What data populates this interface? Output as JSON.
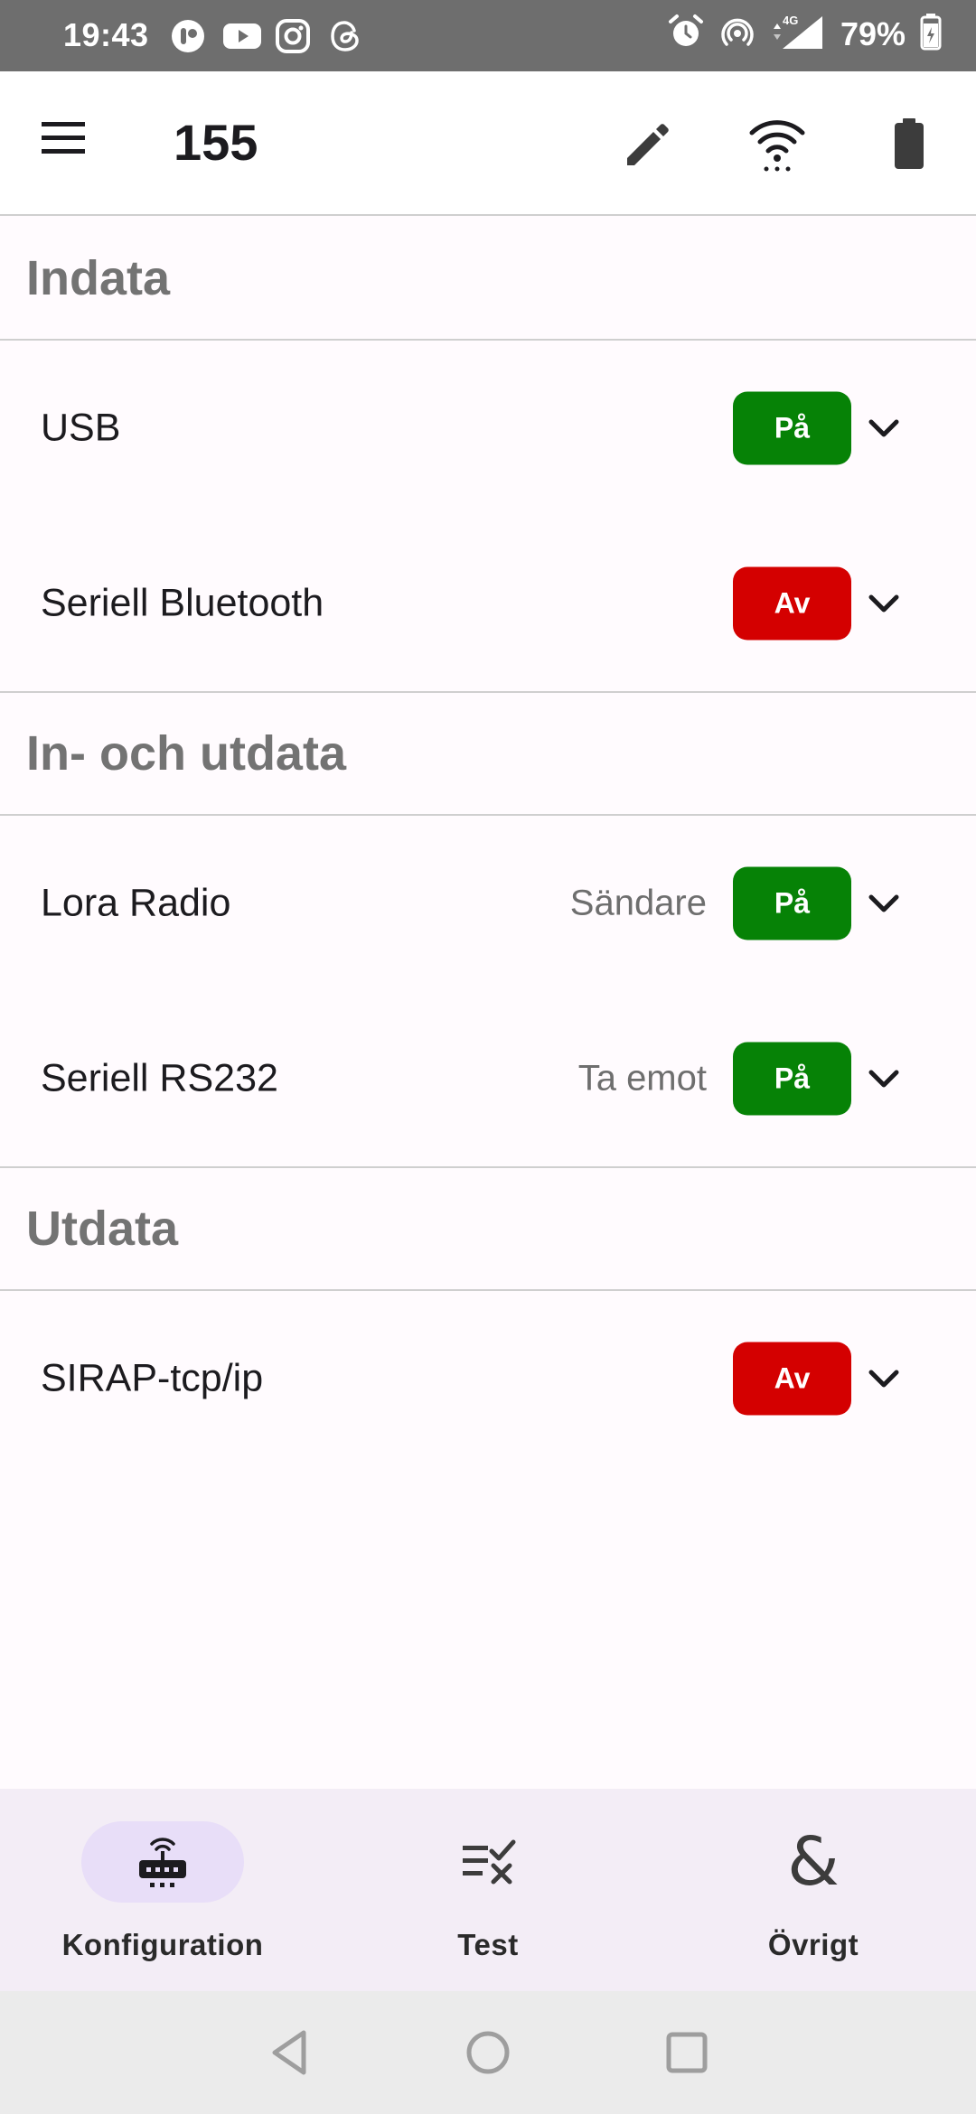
{
  "status_bar": {
    "time": "19:43",
    "battery_percent": "79%",
    "network": "4G"
  },
  "app_bar": {
    "title": "155"
  },
  "sections": [
    {
      "title": "Indata",
      "rows": [
        {
          "label": "USB",
          "mode": "",
          "state": "På",
          "on": true
        },
        {
          "label": "Seriell Bluetooth",
          "mode": "",
          "state": "Av",
          "on": false
        }
      ]
    },
    {
      "title": "In- och utdata",
      "rows": [
        {
          "label": "Lora Radio",
          "mode": "Sändare",
          "state": "På",
          "on": true
        },
        {
          "label": "Seriell RS232",
          "mode": "Ta emot",
          "state": "På",
          "on": true
        }
      ]
    },
    {
      "title": "Utdata",
      "rows": [
        {
          "label": "SIRAP-tcp/ip",
          "mode": "",
          "state": "Av",
          "on": false
        }
      ]
    }
  ],
  "bottom_nav": [
    {
      "label": "Konfiguration",
      "icon": "router-icon",
      "active": true
    },
    {
      "label": "Test",
      "icon": "checklist-icon",
      "active": false
    },
    {
      "label": "Övrigt",
      "icon": "ampersand-icon",
      "active": false
    }
  ],
  "colors": {
    "on": "#068206",
    "off": "#d40000",
    "active_nav": "#e8def8"
  }
}
